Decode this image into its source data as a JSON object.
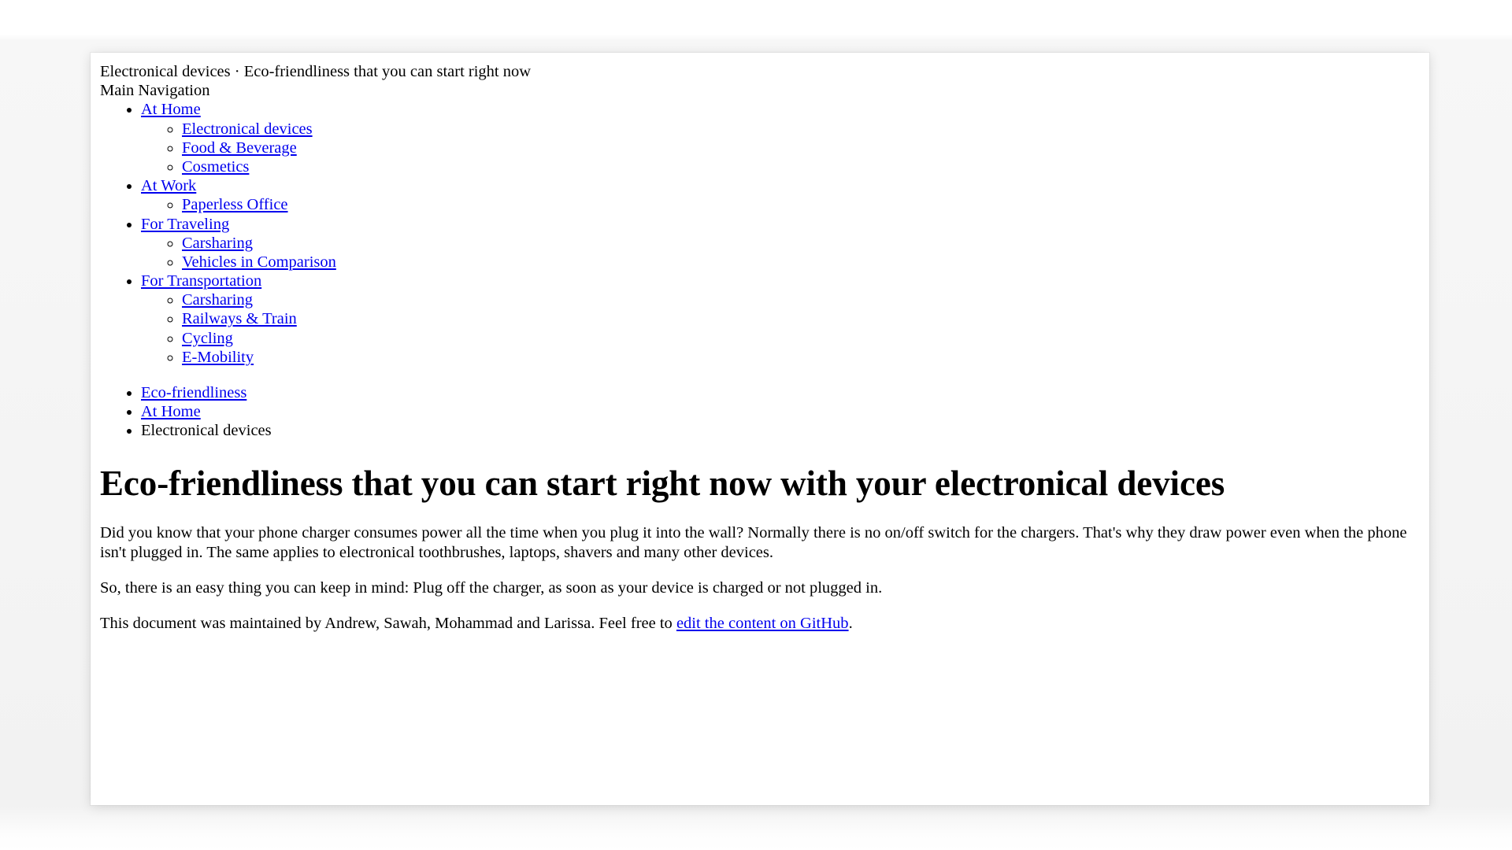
{
  "document": {
    "title_line": "Electronical devices · Eco-friendliness that you can start right now",
    "nav_label": "Main Navigation"
  },
  "main_navigation": {
    "items": [
      {
        "label": "At Home",
        "is_link": true,
        "children": [
          {
            "label": "Electronical devices",
            "is_link": true
          },
          {
            "label": "Food & Beverage",
            "is_link": true
          },
          {
            "label": "Cosmetics",
            "is_link": true
          }
        ]
      },
      {
        "label": "At Work",
        "is_link": true,
        "children": [
          {
            "label": "Paperless Office",
            "is_link": true
          }
        ]
      },
      {
        "label": "For Traveling",
        "is_link": true,
        "children": [
          {
            "label": "Carsharing",
            "is_link": true
          },
          {
            "label": "Vehicles in Comparison",
            "is_link": true
          }
        ]
      },
      {
        "label": "For Transportation",
        "is_link": true,
        "children": [
          {
            "label": "Carsharing",
            "is_link": true
          },
          {
            "label": "Railways & Train",
            "is_link": true
          },
          {
            "label": "Cycling",
            "is_link": true
          },
          {
            "label": "E-Mobility",
            "is_link": true
          }
        ]
      }
    ]
  },
  "breadcrumb": {
    "items": [
      {
        "label": "Eco-friendliness",
        "is_link": true
      },
      {
        "label": "At Home",
        "is_link": true
      },
      {
        "label": "Electronical devices",
        "is_link": false
      }
    ]
  },
  "article": {
    "heading": "Eco-friendliness that you can start right now with your electronical devices",
    "paragraph_1": "Did you know that your phone charger consumes power all the time when you plug it into the wall? Normally there is no on/off switch for the chargers. That's why they draw power even when the phone isn't plugged in. The same applies to electronical toothbrushes, laptops, shavers and many other devices.",
    "paragraph_2": "So, there is an easy thing you can keep in mind: Plug off the charger, as soon as your device is charged or not plugged in.",
    "footer_prefix": "This document was maintained by Andrew, Sawah, Mohammad and Larissa. Feel free to ",
    "footer_link": "edit the content on GitHub",
    "footer_suffix": "."
  },
  "colors": {
    "link": "#0000ee",
    "text": "#000000",
    "page_background": "#ffffff",
    "backdrop": "#f2f2f2"
  }
}
